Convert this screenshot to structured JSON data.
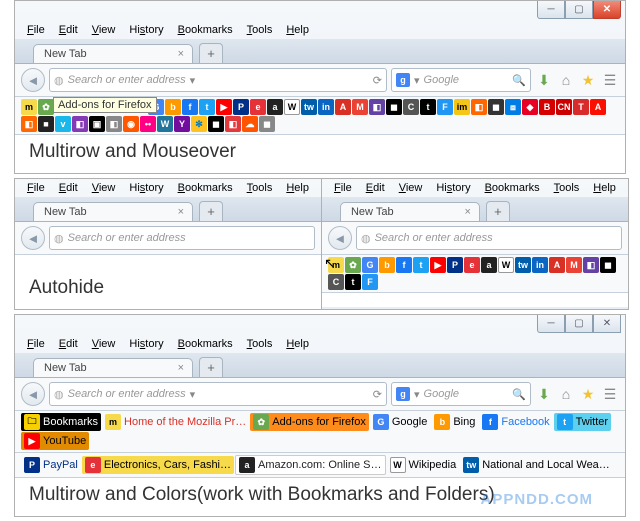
{
  "menus": [
    "File",
    "Edit",
    "View",
    "History",
    "Bookmarks",
    "Tools",
    "Help"
  ],
  "tab_label": "New Tab",
  "url_placeholder": "Search or enter address",
  "search_engine": "Google",
  "search_letter": "g",
  "tooltip_addons": "Add-ons for Firefox",
  "captions": {
    "p1": "Multirow and Mouseover",
    "p2": "Autohide",
    "p3": "Multirow and Colors(work with Bookmarks and Folders)"
  },
  "panel3_items": {
    "bookmarks": "Bookmarks",
    "mozilla": "Home of the Mozilla Pr…",
    "addons": "Add-ons for Firefox",
    "google": "Google",
    "bing": "Bing",
    "facebook": "Facebook",
    "twitter": "Twitter",
    "youtube": "YouTube",
    "paypal": "PayPal",
    "ebay": "Electronics, Cars, Fashi…",
    "amazon": "Amazon.com: Online S…",
    "wiki": "Wikipedia",
    "weather": "National and Local Wea…"
  },
  "watermark": "APPNDD.COM"
}
